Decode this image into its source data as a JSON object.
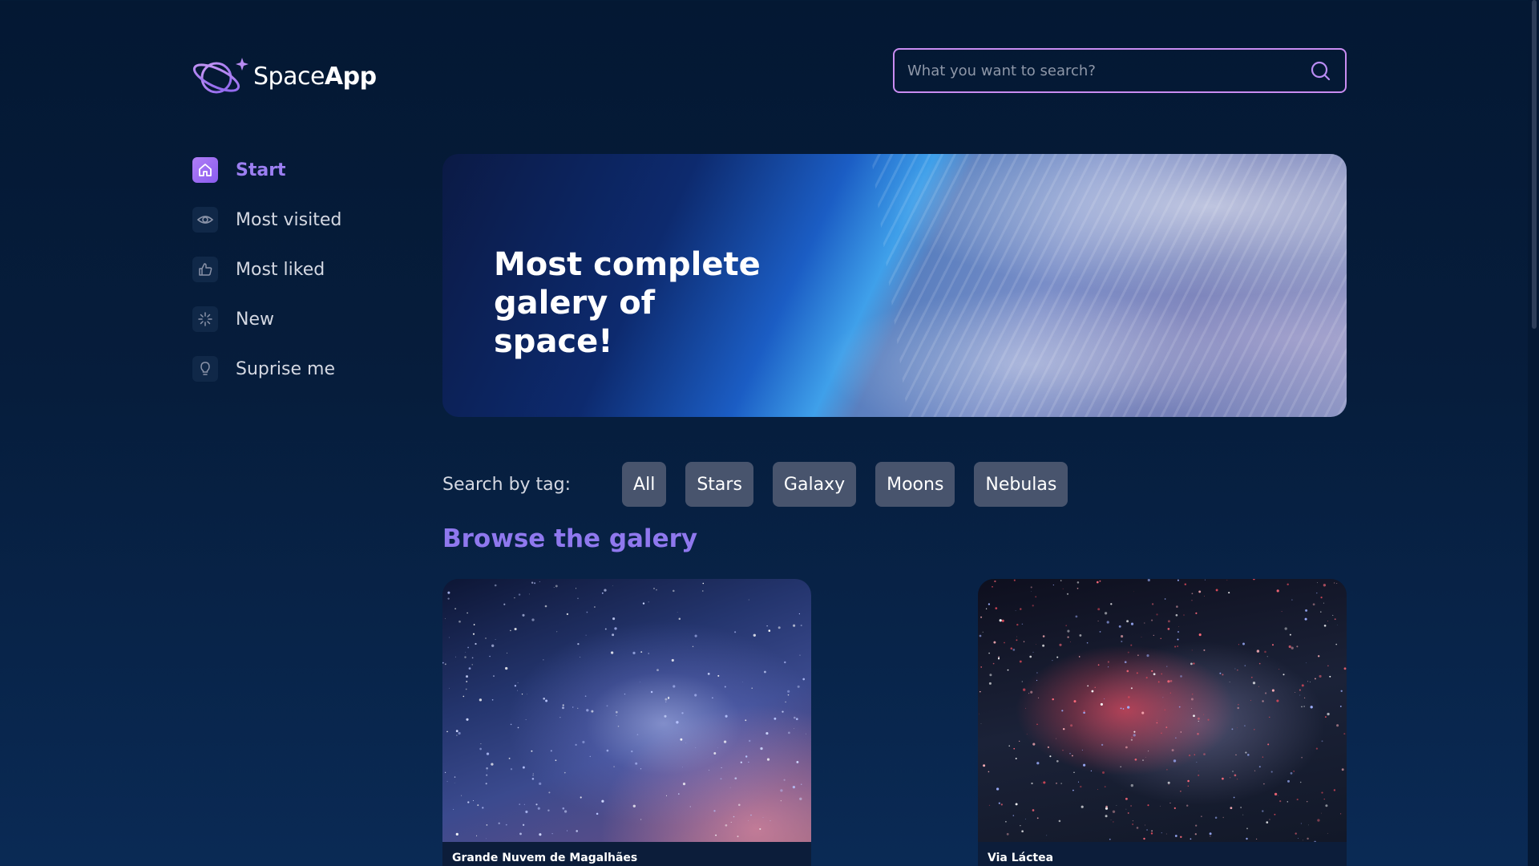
{
  "app": {
    "name_light": "Space",
    "name_bold": "App"
  },
  "search": {
    "placeholder": "What you want to search?",
    "value": ""
  },
  "sidebar": {
    "items": [
      {
        "label": "Start",
        "icon": "home-icon",
        "active": true
      },
      {
        "label": "Most visited",
        "icon": "eye-icon",
        "active": false
      },
      {
        "label": "Most liked",
        "icon": "thumbs-up-icon",
        "active": false
      },
      {
        "label": "New",
        "icon": "sparkle-icon",
        "active": false
      },
      {
        "label": "Suprise me",
        "icon": "lightbulb-icon",
        "active": false
      }
    ]
  },
  "banner": {
    "title": "Most complete galery of space!"
  },
  "tags": {
    "label": "Search by tag:",
    "items": [
      "All",
      "Stars",
      "Galaxy",
      "Moons",
      "Nebulas"
    ]
  },
  "gallery": {
    "title": "Browse the galery",
    "cards": [
      {
        "caption": "Grande Nuvem de Magalhães"
      },
      {
        "caption": "Via Láctea"
      }
    ]
  },
  "colors": {
    "background": "#041833",
    "accent": "#9c7ff2",
    "search_border": "#c98cf1",
    "tag_bg": "#48546d"
  }
}
